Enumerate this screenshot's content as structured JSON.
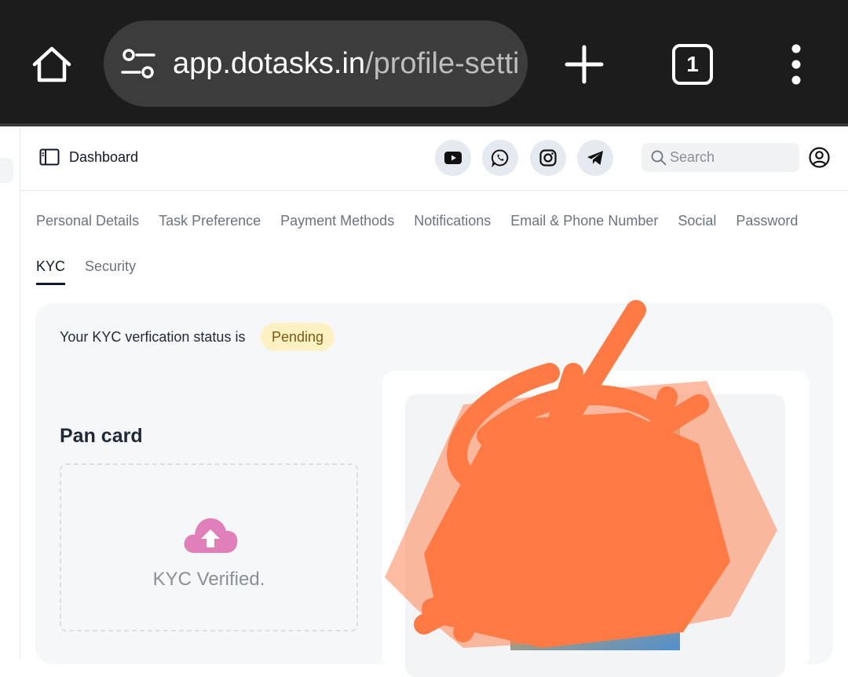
{
  "browser": {
    "url_host": "app.dotasks.in",
    "url_path": "/profile-setti",
    "tab_count": "1"
  },
  "header": {
    "sidebar_label": "Dashboard",
    "search_placeholder": "Search"
  },
  "tabs": [
    {
      "label": "Personal Details",
      "active": false
    },
    {
      "label": "Task Preference",
      "active": false
    },
    {
      "label": "Payment Methods",
      "active": false
    },
    {
      "label": "Notifications",
      "active": false
    },
    {
      "label": "Email & Phone Number",
      "active": false
    },
    {
      "label": "Social",
      "active": false
    },
    {
      "label": "Password",
      "active": false
    },
    {
      "label": "KYC",
      "active": true
    },
    {
      "label": "Security",
      "active": false
    }
  ],
  "kyc": {
    "status_text": "Your KYC verfication status is",
    "status_badge": "Pending",
    "pan_title": "Pan card",
    "upload_text": "KYC Verified."
  },
  "colors": {
    "badge_bg": "#fdf0c2",
    "upload_icon": "#e07fb8",
    "scribble": "#ff7a45"
  }
}
